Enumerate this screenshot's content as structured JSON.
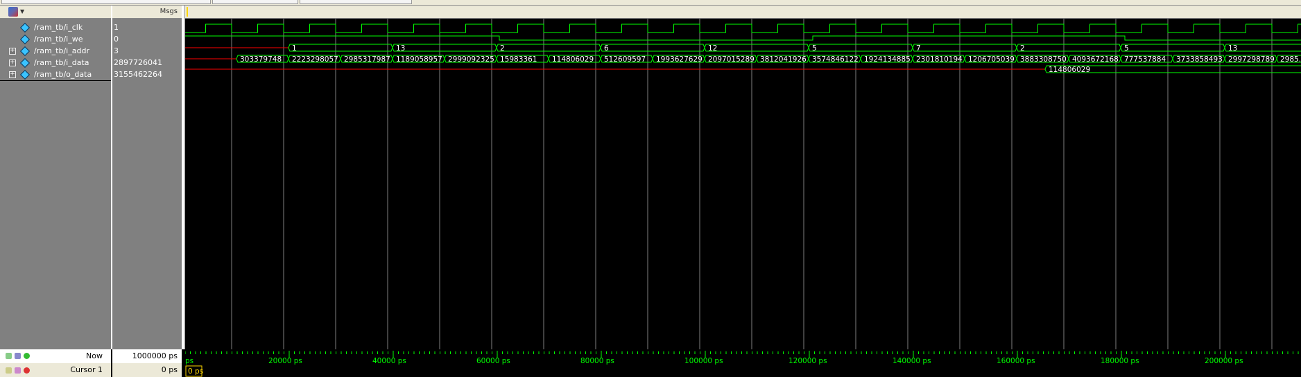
{
  "header": {
    "msgs_label": "Msgs"
  },
  "signals": [
    {
      "name": "/ram_tb/i_clk",
      "value": "1",
      "expandable": false,
      "type": "clock"
    },
    {
      "name": "/ram_tb/i_we",
      "value": "0",
      "expandable": false,
      "type": "bit"
    },
    {
      "name": "/ram_tb/i_addr",
      "value": "3",
      "expandable": true,
      "type": "bus"
    },
    {
      "name": "/ram_tb/i_data",
      "value": "2897726041",
      "expandable": true,
      "type": "bus"
    },
    {
      "name": "/ram_tb/o_data",
      "value": "3155462264",
      "expandable": true,
      "type": "bus"
    }
  ],
  "waveforms": {
    "i_addr_values": [
      "1",
      "13",
      "2",
      "6",
      "12",
      "5",
      "7",
      "2",
      "5",
      "13"
    ],
    "i_data_values": [
      "303379748",
      "2223298057",
      "2985317987",
      "1189058957",
      "2999092325",
      "15983361",
      "114806029",
      "512609597",
      "1993627629",
      "2097015289",
      "3812041926",
      "3574846122",
      "1924134885",
      "2301810194",
      "1206705039",
      "3883308750",
      "4093672168",
      "777537884",
      "3733858493",
      "2997298789",
      "2985..."
    ],
    "o_data_values": [
      "114806029"
    ]
  },
  "timeline": {
    "ticks": [
      "ps",
      "20000 ps",
      "40000 ps",
      "60000 ps",
      "80000 ps",
      "100000 ps",
      "120000 ps",
      "140000 ps",
      "160000 ps",
      "180000 ps",
      "200000 ps"
    ],
    "now_label": "Now",
    "now_value": "1000000 ps",
    "cursor_label": "Cursor 1",
    "cursor_value": "0 ps",
    "cursor_marker": "0 ps"
  },
  "colors": {
    "wave_green": "#00ff00",
    "bus_text": "#ffffff",
    "undefined_red": "#ff0000",
    "grid_gray": "#7f7f7f",
    "cursor_yellow": "#ffd700"
  },
  "icons": {
    "header": "wave-config-icon",
    "bottom_left": [
      "zoom-icon",
      "window-icon",
      "add-icon",
      "lock-icon",
      "edit-icon",
      "delete-icon"
    ]
  }
}
